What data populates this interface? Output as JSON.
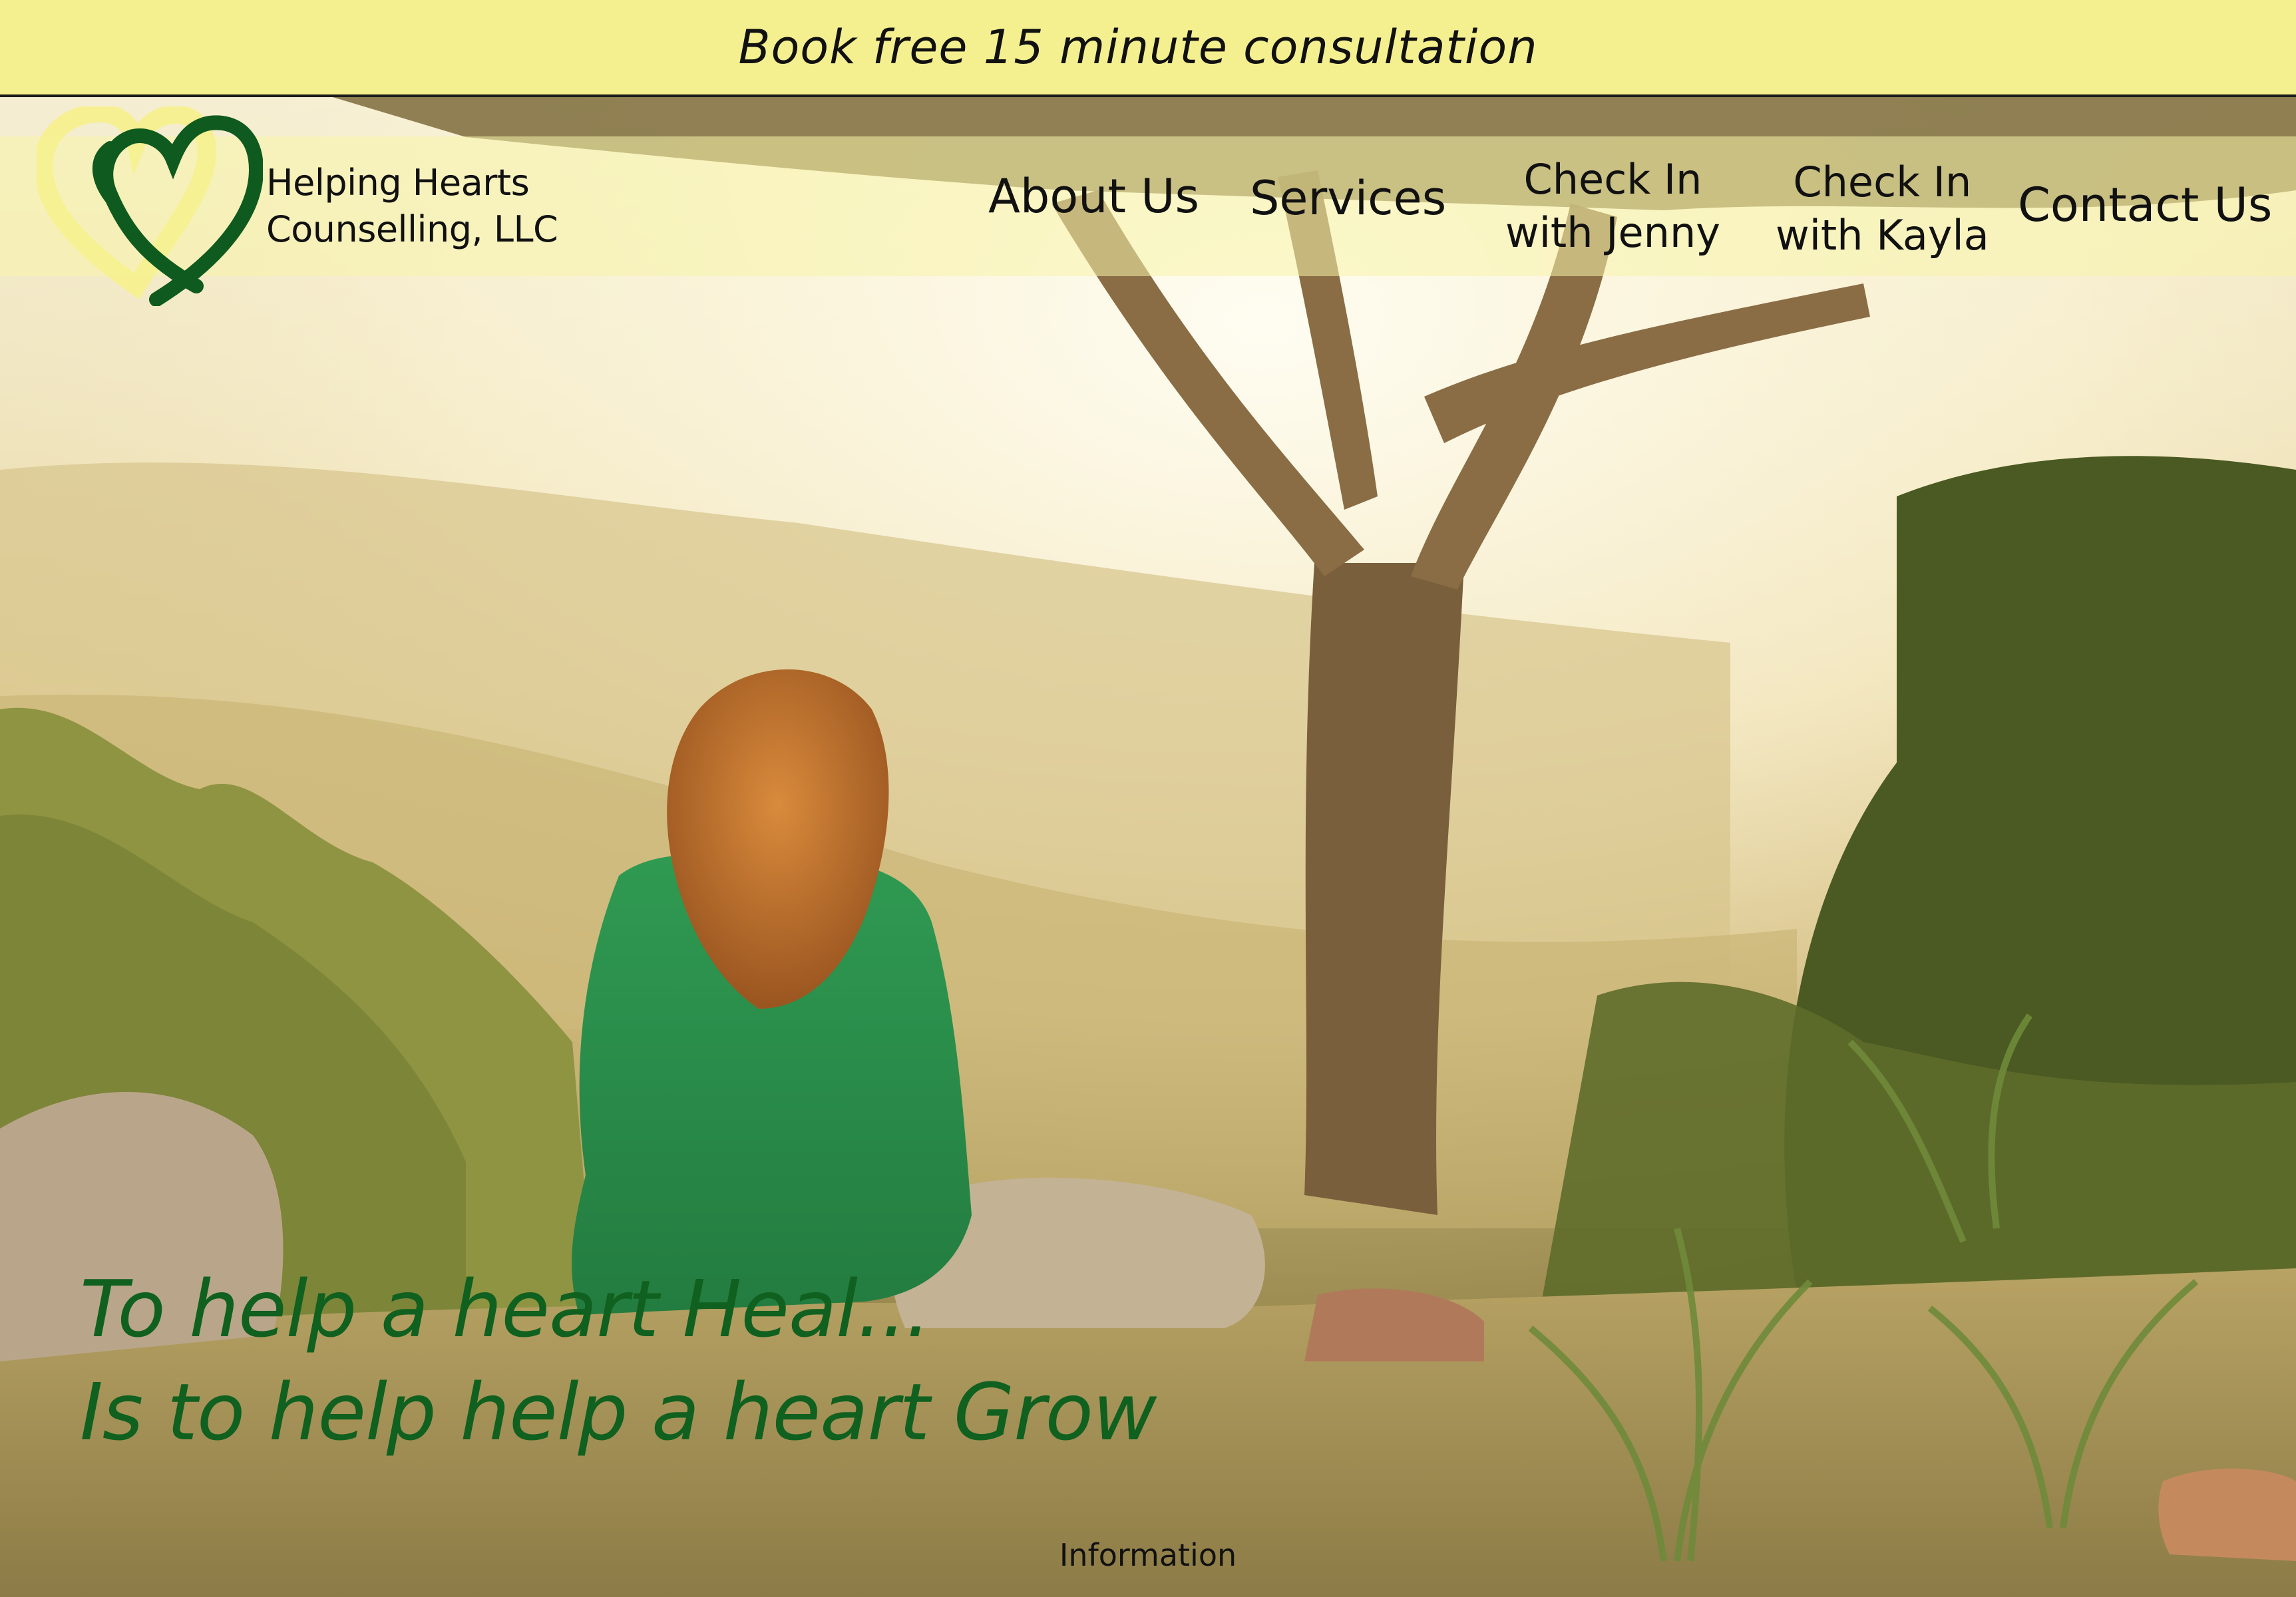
{
  "banner": {
    "label": "Book free 15 minute consultation",
    "color": "#f5f08f"
  },
  "header": {
    "logo_icon": "heart-logo-icon",
    "brand_line1": "Helping Hearts",
    "brand_line2": "Counselling, LLC"
  },
  "nav": {
    "about": "About Us",
    "services": "Services",
    "jenny_line1": "Check In",
    "jenny_line2": "with Jenny",
    "kayla_line1": "Check In",
    "kayla_line2": "with Kayla",
    "contact": "Contact Us"
  },
  "hero": {
    "tagline_line1": "To help a heart Heal...",
    "tagline_line2": "Is to help help a heart Grow",
    "tagline_color": "#10601f"
  },
  "footer": {
    "information": "Information"
  }
}
